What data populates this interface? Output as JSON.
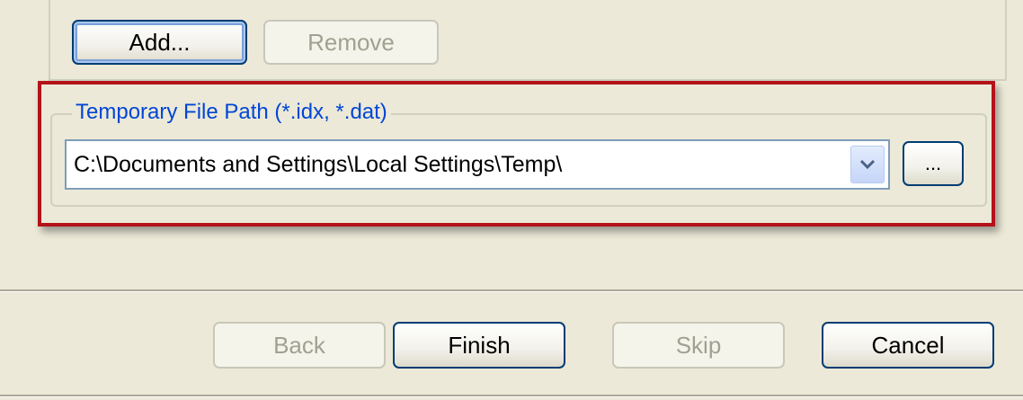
{
  "list_buttons": {
    "add_label": "Add...",
    "remove_label": "Remove"
  },
  "temp_path": {
    "group_title": "Temporary File Path (*.idx, *.dat)",
    "value": "C:\\Documents and Settings\\Local Settings\\Temp\\",
    "browse_label": "..."
  },
  "footer": {
    "back_label": "Back",
    "finish_label": "Finish",
    "skip_label": "Skip",
    "cancel_label": "Cancel"
  },
  "colors": {
    "window_bg": "#ece9d8",
    "group_title": "#0046d5",
    "highlight_border": "#b4121a",
    "button_border": "#003c74"
  },
  "icons": {
    "dropdown": "chevron-down-icon"
  }
}
